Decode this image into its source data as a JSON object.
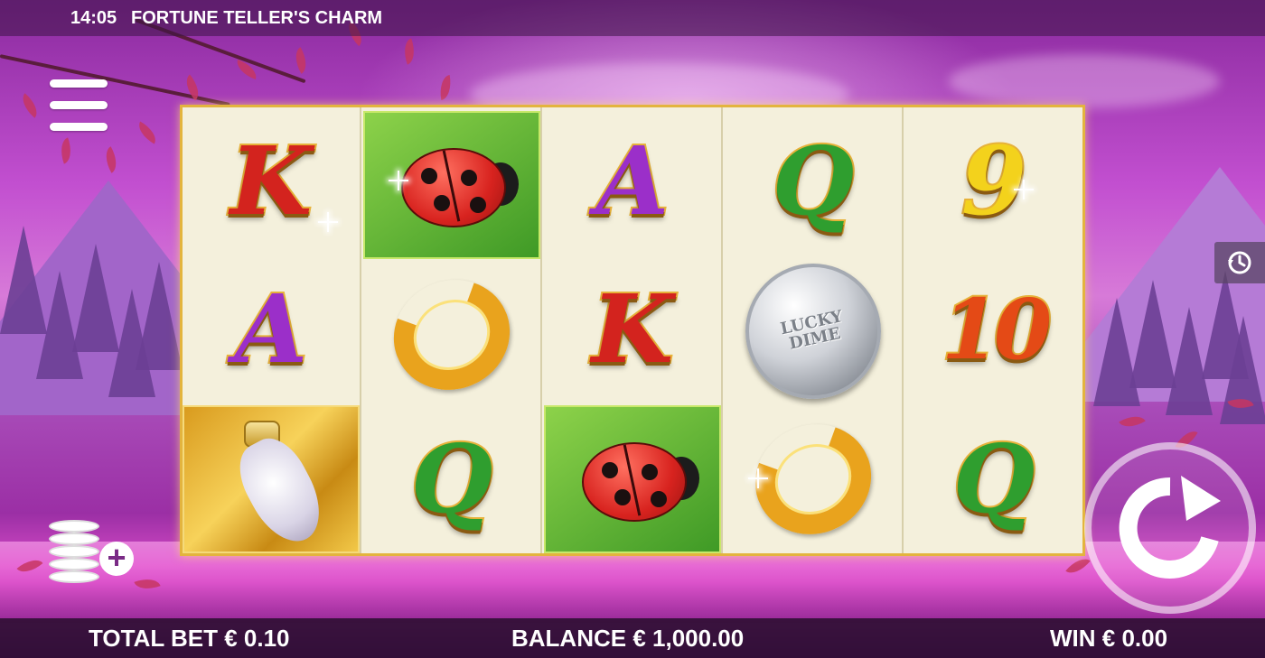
{
  "topbar": {
    "time": "14:05",
    "title": "FORTUNE TELLER'S CHARM"
  },
  "reels": [
    [
      {
        "symbol": "K",
        "color": "red"
      },
      {
        "symbol": "A",
        "color": "purple"
      },
      {
        "symbol": "rabbit-foot"
      }
    ],
    [
      {
        "symbol": "ladybug"
      },
      {
        "symbol": "horseshoe"
      },
      {
        "symbol": "Q",
        "color": "green"
      }
    ],
    [
      {
        "symbol": "A",
        "color": "purple"
      },
      {
        "symbol": "K",
        "color": "red"
      },
      {
        "symbol": "ladybug"
      }
    ],
    [
      {
        "symbol": "Q",
        "color": "green"
      },
      {
        "symbol": "coin",
        "text": "LUCKY\nDIME"
      },
      {
        "symbol": "horseshoe"
      }
    ],
    [
      {
        "symbol": "9",
        "color": "yellow"
      },
      {
        "symbol": "10",
        "color": "orange"
      },
      {
        "symbol": "Q",
        "color": "green"
      }
    ]
  ],
  "controls": {
    "menu_icon": "hamburger-menu-icon",
    "bet_icon": "coin-stack-plus-icon",
    "history_icon": "history-clock-icon",
    "spin_icon": "spin-arrow-icon"
  },
  "bottombar": {
    "total_bet": "TOTAL BET € 0.10",
    "balance": "BALANCE € 1,000.00",
    "win": "WIN € 0.00"
  },
  "colors": {
    "reel_border": "#e3b43e",
    "reel_background": "#f4f0dc",
    "sky": "#c24fd0"
  }
}
